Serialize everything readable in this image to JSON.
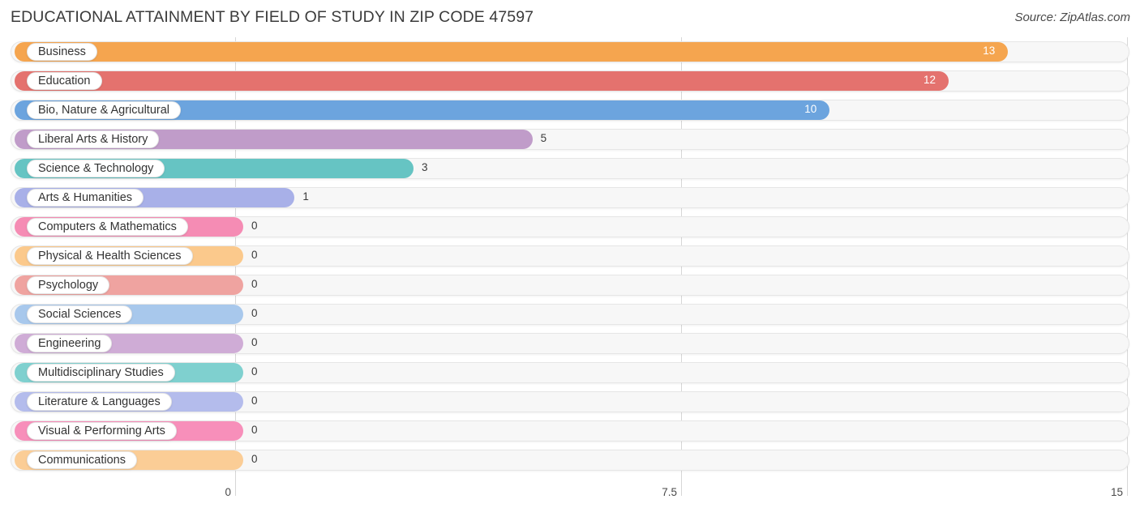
{
  "header": {
    "title": "EDUCATIONAL ATTAINMENT BY FIELD OF STUDY IN ZIP CODE 47597",
    "source": "Source: ZipAtlas.com"
  },
  "chart_data": {
    "type": "bar",
    "orientation": "horizontal",
    "title": "EDUCATIONAL ATTAINMENT BY FIELD OF STUDY IN ZIP CODE 47597",
    "subtitle": "Source: ZipAtlas.com",
    "xlabel": "",
    "ylabel": "",
    "xlim": [
      0,
      15
    ],
    "grid": true,
    "legend": "none",
    "xticks": [
      "0",
      "7.5",
      "15"
    ],
    "xtick_values": [
      0,
      7.5,
      15
    ],
    "categories": [
      "Business",
      "Education",
      "Bio, Nature & Agricultural",
      "Liberal Arts & History",
      "Science & Technology",
      "Arts & Humanities",
      "Computers & Mathematics",
      "Physical & Health Sciences",
      "Psychology",
      "Social Sciences",
      "Engineering",
      "Multidisciplinary Studies",
      "Literature & Languages",
      "Visual & Performing Arts",
      "Communications"
    ],
    "values": [
      13,
      12,
      10,
      5,
      3,
      1,
      0,
      0,
      0,
      0,
      0,
      0,
      0,
      0,
      0
    ],
    "value_labels": [
      "13",
      "12",
      "10",
      "5",
      "3",
      "1",
      "0",
      "0",
      "0",
      "0",
      "0",
      "0",
      "0",
      "0",
      "0"
    ],
    "colors": [
      "#f5a54f",
      "#e4726e",
      "#6ca4de",
      "#c09cc9",
      "#66c4c3",
      "#a8b0e8",
      "#f58cb4",
      "#fbc98c",
      "#efa3a0",
      "#a8c8ec",
      "#cfacd6",
      "#7fd0cf",
      "#b4bcec",
      "#f78fba",
      "#fbcd96"
    ]
  }
}
